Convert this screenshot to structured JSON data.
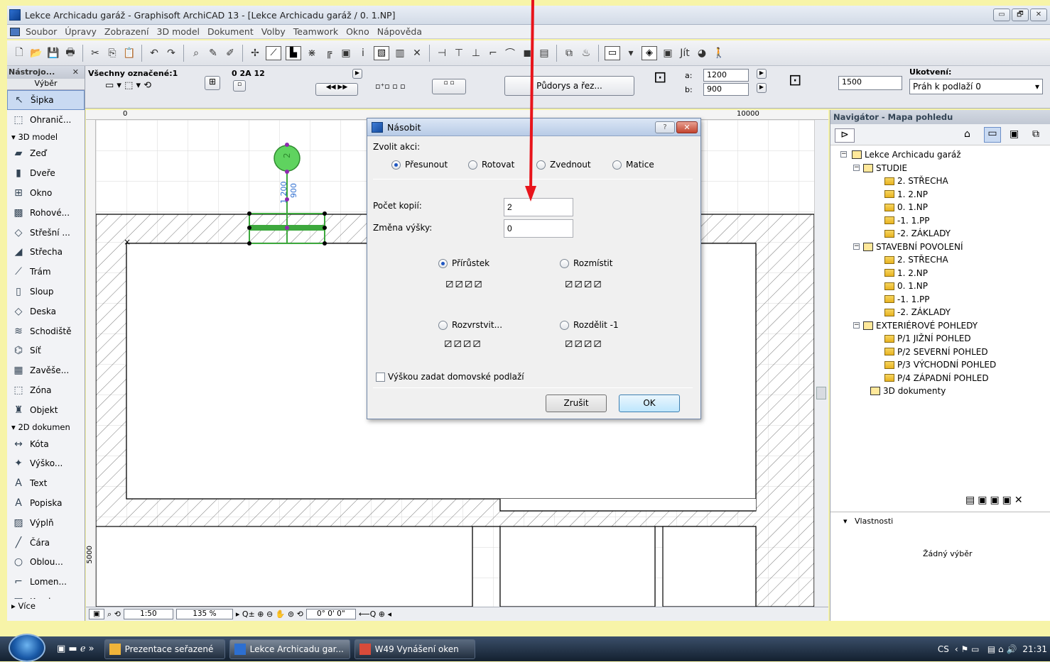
{
  "window": {
    "title": "Lekce Archicadu garáž - Graphisoft ArchiCAD 13 - [Lekce Archicadu garáž / 0. 1.NP]",
    "buttons": [
      "▭",
      "🗗",
      "✕"
    ]
  },
  "menu": [
    "Soubor",
    "Úpravy",
    "Zobrazení",
    "3D model",
    "Dokument",
    "Volby",
    "Teamwork",
    "Okno",
    "Nápověda"
  ],
  "infobox": {
    "selection": "Všechny označené:1",
    "layer_code": "0 2A 12",
    "view_button": "Půdorys a řez...",
    "a_label": "a:",
    "a_value": "1200",
    "b_label": "b:",
    "b_value": "900",
    "height_value": "1500",
    "anchor_label": "Ukotvení:",
    "anchor_value": "Práh k podlaží 0"
  },
  "palette": {
    "title": "Nástrojo...",
    "close": "✕",
    "select_label": "Výběr",
    "groups": {
      "model": "3D model",
      "doc": "2D dokumen",
      "more": "Více"
    },
    "tools_top": [
      {
        "label": "Šipka",
        "icon": "↖"
      },
      {
        "label": "Ohranič...",
        "icon": "⬚"
      }
    ],
    "tools_model": [
      {
        "label": "Zeď",
        "icon": "▰"
      },
      {
        "label": "Dveře",
        "icon": "▮"
      },
      {
        "label": "Okno",
        "icon": "⊞"
      },
      {
        "label": "Rohové...",
        "icon": "▩"
      },
      {
        "label": "Střešní ...",
        "icon": "◇"
      },
      {
        "label": "Střecha",
        "icon": "◢"
      },
      {
        "label": "Trám",
        "icon": "⟋"
      },
      {
        "label": "Sloup",
        "icon": "▯"
      },
      {
        "label": "Deska",
        "icon": "◇"
      },
      {
        "label": "Schodiště",
        "icon": "≋"
      },
      {
        "label": "Síť",
        "icon": "⌬"
      },
      {
        "label": "Zavěše...",
        "icon": "▦"
      },
      {
        "label": "Zóna",
        "icon": "⬚"
      },
      {
        "label": "Objekt",
        "icon": "♜"
      }
    ],
    "tools_doc": [
      {
        "label": "Kóta",
        "icon": "↔"
      },
      {
        "label": "Výško...",
        "icon": "✦"
      },
      {
        "label": "Text",
        "icon": "A"
      },
      {
        "label": "Popiska",
        "icon": "A"
      },
      {
        "label": "Výplň",
        "icon": "▨"
      },
      {
        "label": "Čára",
        "icon": "╱"
      },
      {
        "label": "Oblou...",
        "icon": "○"
      },
      {
        "label": "Lomen...",
        "icon": "⌐"
      },
      {
        "label": "Kresba",
        "icon": "▤"
      }
    ]
  },
  "ruler": {
    "zero": "0",
    "right": "10000",
    "vertical": "5000"
  },
  "status": {
    "scale": "1:50",
    "zoom": "135 %",
    "angle": "0° 0' 0\""
  },
  "dialog": {
    "title": "Násobit",
    "help": "?",
    "close": "✕",
    "action_label": "Zvolit akci:",
    "actions": [
      "Přesunout",
      "Rotovat",
      "Zvednout",
      "Matice"
    ],
    "action_selected": "Přesunout",
    "copies_label": "Počet kopií:",
    "copies_value": "2",
    "height_label": "Změna výšky:",
    "height_value": "0",
    "modes": [
      "Přírůstek",
      "Rozmístit",
      "Rozvrstvit...",
      "Rozdělit -1"
    ],
    "mode_selected": "Přírůstek",
    "checkbox_label": "Výškou zadat domovské podlaží",
    "cancel": "Zrušit",
    "ok": "OK"
  },
  "navigator": {
    "title": "Navigátor - Mapa pohledu",
    "project": "Lekce Archicadu garáž",
    "sets": [
      {
        "name": "STUDIE",
        "items": [
          "2. STŘECHA",
          "1. 2.NP",
          "0. 1.NP",
          "-1. 1.PP",
          "-2. ZÁKLADY"
        ]
      },
      {
        "name": "STAVEBNÍ POVOLENÍ",
        "items": [
          "2. STŘECHA",
          "1. 2.NP",
          "0. 1.NP",
          "-1. 1.PP",
          "-2. ZÁKLADY"
        ]
      },
      {
        "name": "EXTERIÉROVÉ POHLEDY",
        "items": [
          "P/1 JIŽNÍ POHLED",
          "P/2 SEVERNÍ POHLED",
          "P/3 VÝCHODNÍ POHLED",
          "P/4 ZÁPADNÍ POHLED"
        ]
      }
    ],
    "docs": "3D dokumenty",
    "props_label": "Vlastnosti",
    "props_empty": "Žádný výběr"
  },
  "window_dims": {
    "a": "1 200",
    "b": "900"
  },
  "taskbar": {
    "apps": [
      "Prezentace seřazené",
      "Lekce Archicadu gar...",
      "W49 Vynášení oken"
    ],
    "lang": "CS",
    "clock": "21:31"
  },
  "colors": {
    "arrow": "#e8141b",
    "window_mark": "#3da83d",
    "selection": "#8f2ab0"
  }
}
